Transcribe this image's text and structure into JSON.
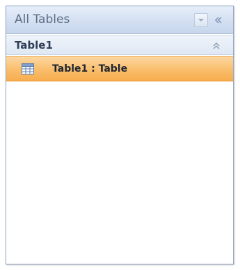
{
  "pane": {
    "title": "All Tables",
    "dropdown_icon": "chevron-down-icon",
    "shutter_icon": "double-chevron-left-icon"
  },
  "group": {
    "title": "Table1",
    "collapse_icon": "double-chevron-up-icon"
  },
  "items": [
    {
      "label": "Table1 : Table",
      "icon": "table-icon",
      "selected": true
    }
  ],
  "colors": {
    "header_bg": "#d5e1f2",
    "selected_bg": "#f9bd6a",
    "border": "#8fa5c2"
  }
}
